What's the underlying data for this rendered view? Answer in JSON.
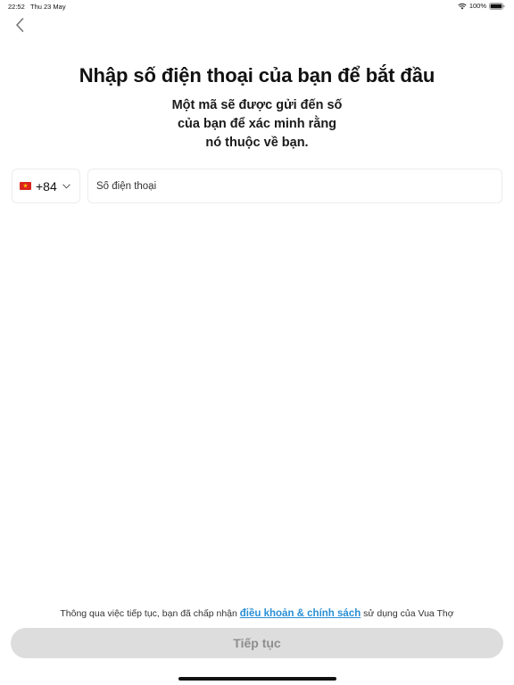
{
  "status_bar": {
    "time": "22:52",
    "date": "Thu 23 May",
    "battery": "100%"
  },
  "header": {
    "back_icon": "chevron-left-icon",
    "title": "Nhập số điện thoại của bạn để bắt đầu",
    "subtitle_lines": [
      "Một mã sẽ được gửi đến số",
      "của bạn để xác minh rằng",
      "nó thuộc về bạn."
    ]
  },
  "phone_form": {
    "country_flag_icon": "vietnam-flag-icon",
    "dial_code": "+84",
    "phone_placeholder": "Số điện thoại",
    "phone_value": ""
  },
  "footer": {
    "terms_prefix": "Thông qua việc tiếp tục, bạn đã chấp nhận ",
    "terms_link": "điều khoản & chính sách",
    "terms_suffix": " sử dụng của Vua Thợ",
    "continue_label": "Tiếp tục"
  },
  "colors": {
    "link": "#2a8fd6",
    "button_disabled_bg": "#dddddd",
    "button_disabled_text": "#8e8e8e",
    "flag_red": "#da251d",
    "flag_star": "#ffcd00"
  }
}
